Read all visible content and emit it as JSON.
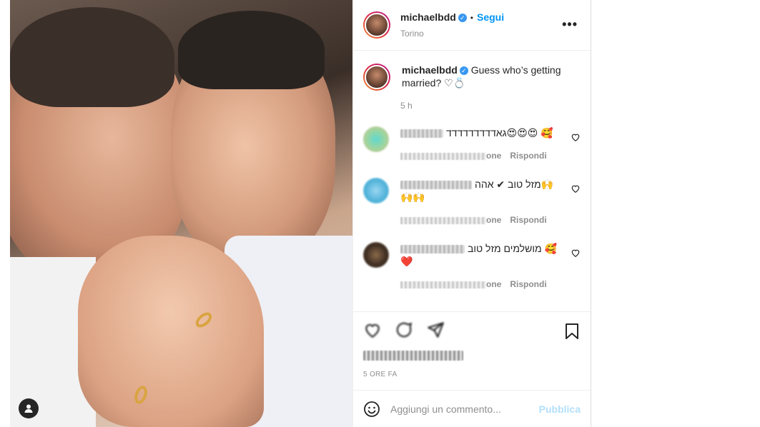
{
  "post": {
    "username": "michaelbdd",
    "verified_icon": "verified-badge-icon",
    "separator": "•",
    "follow_label": "Segui",
    "location": "Torino",
    "more_icon": "more-options-icon",
    "more_glyph": "•••"
  },
  "caption": {
    "username": "michaelbdd",
    "text": "Guess who’s getting married? ♡💍",
    "time": "5 h"
  },
  "comments": [
    {
      "text": "גאדדדדדדדדד😍😍😍 🥰",
      "reply_suffix": "one",
      "reply_label": "Rispondi"
    },
    {
      "text": "מזל טוב ✔ אהה🙌🙌🙌",
      "reply_suffix": "one",
      "reply_label": "Rispondi"
    },
    {
      "text": "מושלמים מזל טוב 🥰❤️",
      "reply_suffix": "one",
      "reply_label": "Rispondi"
    }
  ],
  "actions": {
    "posted_ago": "5 ORE FA"
  },
  "composer": {
    "placeholder": "Aggiungi un commento...",
    "publish_label": "Pubblica"
  },
  "colors": {
    "accent": "#0095f6",
    "publish_disabled": "#b2dffc",
    "muted": "#8e8e8e"
  }
}
